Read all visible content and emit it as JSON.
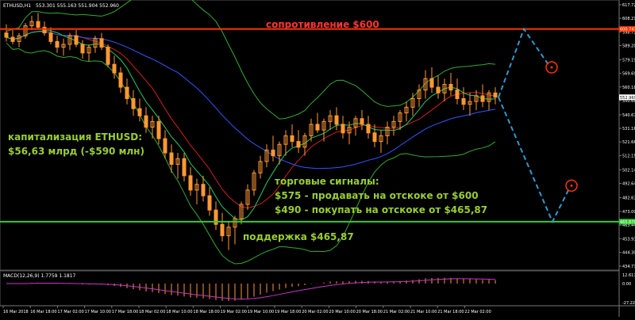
{
  "header": {
    "symbol": "ETHUSD,H1",
    "ohlc": "553.301 555.163 551.904 552.960"
  },
  "annotations": {
    "resistance": "сопротивление $600",
    "cap_title": "капитализация ETHUSD:",
    "cap_value": "$56,63 млрд (-$590 млн)",
    "signals_title": "торговые сигналы:",
    "signal_sell": "$575 - продавать на отскоке от $600",
    "signal_buy": "$490 - покупать на отскоке от $465,87",
    "support": "поддержка $465,87"
  },
  "macd_label": "MACD(12,26,9) 1.7759 1.1817",
  "price_axis": [
    "617.720",
    "608.215",
    "598.710",
    "589.205",
    "579.195",
    "569.690",
    "560.185",
    "550.680",
    "540.670",
    "531.165",
    "521.660",
    "512.155",
    "502.145",
    "492.640",
    "482.635",
    "473.000",
    "463.440",
    "453.935",
    "444.305",
    "434.730"
  ],
  "line_labels": {
    "resistance_price": "600.747",
    "current_price": "552.960",
    "support_price": "465.870"
  },
  "macd_axis": [
    "12.6176",
    "0.00",
    "-27.2237"
  ],
  "time_axis": [
    "16 Mar 2018",
    "16 Mar 18:00",
    "17 Mar 02:00",
    "17 Mar 10:00",
    "17 Mar 18:00",
    "18 Mar 02:00",
    "18 Mar 10:00",
    "18 Mar 18:00",
    "19 Mar 02:00",
    "19 Mar 10:00",
    "19 Mar 18:00",
    "20 Mar 02:00",
    "20 Mar 10:00",
    "20 Mar 18:00",
    "21 Mar 02:00",
    "21 Mar 10:00",
    "21 Mar 18:00",
    "22 Mar 02:00"
  ],
  "colors": {
    "background": "#000000",
    "bull": "#ff9933",
    "bear": "#ff9933",
    "resistance": "#ff3300",
    "support": "#33cc33",
    "bollinger": "#33aa33",
    "ma_red": "#cc2222",
    "ma_blue": "#3355ff",
    "ma_green": "#22cc66",
    "projection": "#3399cc",
    "macd_hist": "#ff9933",
    "macd_signal": "#cc33cc",
    "axis_text": "#ffffff",
    "annotation_green": "#9acd32",
    "annotation_red": "#ff3333"
  },
  "chart_data": {
    "type": "candlestick",
    "price_range": [
      434.73,
      617.72
    ],
    "resistance": 600.747,
    "support": 465.87,
    "current": 552.96,
    "candles": [
      [
        598,
        604,
        592,
        595
      ],
      [
        595,
        600,
        590,
        592
      ],
      [
        592,
        598,
        588,
        596
      ],
      [
        596,
        605,
        594,
        603
      ],
      [
        603,
        610,
        600,
        606
      ],
      [
        606,
        612,
        601,
        602
      ],
      [
        602,
        606,
        596,
        598
      ],
      [
        598,
        602,
        590,
        592
      ],
      [
        592,
        596,
        584,
        588
      ],
      [
        588,
        594,
        582,
        590
      ],
      [
        590,
        598,
        586,
        596
      ],
      [
        596,
        600,
        588,
        590
      ],
      [
        590,
        593,
        580,
        584
      ],
      [
        584,
        590,
        578,
        588
      ],
      [
        588,
        596,
        584,
        594
      ],
      [
        594,
        598,
        586,
        588
      ],
      [
        588,
        590,
        574,
        576
      ],
      [
        576,
        582,
        566,
        570
      ],
      [
        570,
        574,
        556,
        560
      ],
      [
        560,
        566,
        548,
        552
      ],
      [
        552,
        558,
        540,
        545
      ],
      [
        545,
        552,
        536,
        540
      ],
      [
        540,
        546,
        528,
        532
      ],
      [
        532,
        540,
        524,
        536
      ],
      [
        536,
        540,
        520,
        524
      ],
      [
        524,
        530,
        510,
        514
      ],
      [
        514,
        520,
        500,
        506
      ],
      [
        506,
        514,
        496,
        510
      ],
      [
        510,
        514,
        494,
        498
      ],
      [
        498,
        504,
        484,
        488
      ],
      [
        488,
        496,
        478,
        492
      ],
      [
        492,
        498,
        480,
        484
      ],
      [
        484,
        490,
        470,
        474
      ],
      [
        474,
        480,
        460,
        464
      ],
      [
        464,
        472,
        452,
        456
      ],
      [
        456,
        466,
        446,
        462
      ],
      [
        462,
        470,
        450,
        468
      ],
      [
        468,
        480,
        464,
        478
      ],
      [
        478,
        492,
        474,
        488
      ],
      [
        488,
        502,
        484,
        500
      ],
      [
        500,
        512,
        496,
        508
      ],
      [
        508,
        520,
        504,
        516
      ],
      [
        516,
        526,
        508,
        512
      ],
      [
        512,
        522,
        506,
        520
      ],
      [
        520,
        530,
        512,
        526
      ],
      [
        526,
        534,
        518,
        522
      ],
      [
        522,
        530,
        514,
        518
      ],
      [
        518,
        528,
        512,
        526
      ],
      [
        526,
        538,
        522,
        534
      ],
      [
        534,
        542,
        528,
        530
      ],
      [
        530,
        538,
        522,
        536
      ],
      [
        536,
        544,
        530,
        540
      ],
      [
        540,
        546,
        530,
        534
      ],
      [
        534,
        540,
        524,
        528
      ],
      [
        528,
        536,
        520,
        532
      ],
      [
        532,
        540,
        526,
        538
      ],
      [
        538,
        544,
        530,
        534
      ],
      [
        534,
        540,
        524,
        528
      ],
      [
        528,
        534,
        518,
        522
      ],
      [
        522,
        530,
        514,
        526
      ],
      [
        526,
        536,
        520,
        532
      ],
      [
        532,
        540,
        526,
        536
      ],
      [
        536,
        544,
        530,
        542
      ],
      [
        542,
        550,
        536,
        546
      ],
      [
        546,
        556,
        540,
        552
      ],
      [
        552,
        562,
        546,
        558
      ],
      [
        558,
        572,
        552,
        566
      ],
      [
        566,
        574,
        556,
        560
      ],
      [
        560,
        568,
        552,
        556
      ],
      [
        556,
        566,
        550,
        562
      ],
      [
        562,
        570,
        554,
        558
      ],
      [
        558,
        566,
        548,
        552
      ],
      [
        552,
        560,
        544,
        548
      ],
      [
        548,
        556,
        540,
        550
      ],
      [
        550,
        558,
        544,
        554
      ],
      [
        554,
        562,
        546,
        550
      ],
      [
        550,
        558,
        544,
        556
      ],
      [
        556,
        560,
        548,
        553
      ]
    ],
    "projection": [
      [
        552.96,
        0
      ],
      [
        600,
        10
      ],
      [
        575,
        16
      ],
      [
        465.87,
        10
      ],
      [
        490,
        16
      ]
    ]
  }
}
